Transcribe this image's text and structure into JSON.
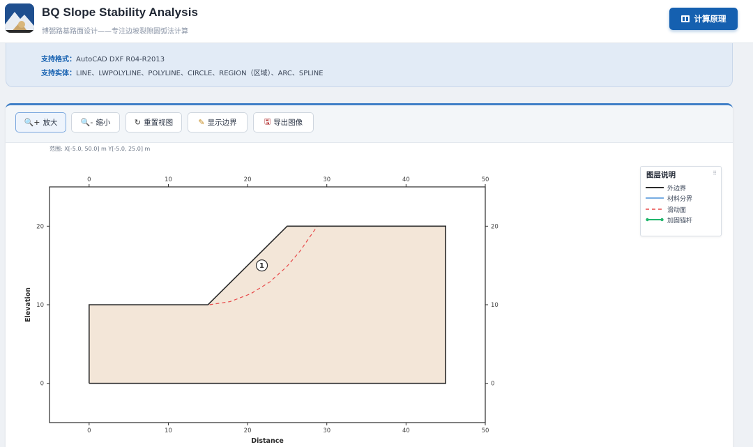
{
  "header": {
    "title": "BQ Slope Stability Analysis",
    "subtitle": "博弼路基路面设计——专注边坡裂隙圆弧法计算",
    "calc_button": "计算原理",
    "logo_icon": "mountain-landslide-logo"
  },
  "info": {
    "formats_label": "支持格式：",
    "formats_value": "AutoCAD DXF R04-R2013",
    "entities_label": "支持实体：",
    "entities_value": "LINE、LWPOLYLINE、POLYLINE、CIRCLE、REGION（区域）、ARC、SPLINE"
  },
  "toolbar": {
    "zoom_in": "放大",
    "zoom_out": "缩小",
    "reset_view": "重置视图",
    "show_boundary": "显示边界",
    "export_image": "导出图像",
    "zoom_in_icon": "🔍+",
    "zoom_out_icon": "🔍-",
    "reset_icon": "↻",
    "boundary_icon": "✎",
    "export_icon": "🖫"
  },
  "range_text": "范围: X[-5.0, 50.0] m  Y[-5.0, 25.0] m",
  "legend": {
    "title": "图层说明",
    "items": [
      {
        "label": "外边界",
        "color": "#2b2b2b",
        "style": "solid"
      },
      {
        "label": "材料分界",
        "color": "#4a90d9",
        "style": "solid"
      },
      {
        "label": "滑动面",
        "color": "#e84a4a",
        "style": "dashed"
      },
      {
        "label": "加固锚杆",
        "color": "#1fb56b",
        "style": "dots"
      }
    ]
  },
  "chart_data": {
    "type": "diagram",
    "xlabel": "Distance",
    "ylabel": "Elevation",
    "xlim": [
      -5,
      50
    ],
    "ylim": [
      -5,
      25
    ],
    "xticks": [
      0,
      10,
      20,
      30,
      40,
      50
    ],
    "yticks": [
      0,
      10,
      20
    ],
    "boundary": [
      [
        0,
        0
      ],
      [
        0,
        10
      ],
      [
        15,
        10
      ],
      [
        25,
        20
      ],
      [
        45,
        20
      ],
      [
        45,
        0
      ],
      [
        0,
        0
      ]
    ],
    "fill_color": "#f3e6d8",
    "region_label": "1",
    "region_label_pos": [
      21.8,
      15
    ],
    "slip_surface": [
      [
        15.2,
        10
      ],
      [
        17.8,
        10.4
      ],
      [
        20.4,
        11.4
      ],
      [
        22.8,
        12.9
      ],
      [
        24.9,
        14.8
      ],
      [
        26.6,
        16.8
      ],
      [
        27.9,
        18.7
      ],
      [
        28.8,
        20
      ]
    ]
  }
}
